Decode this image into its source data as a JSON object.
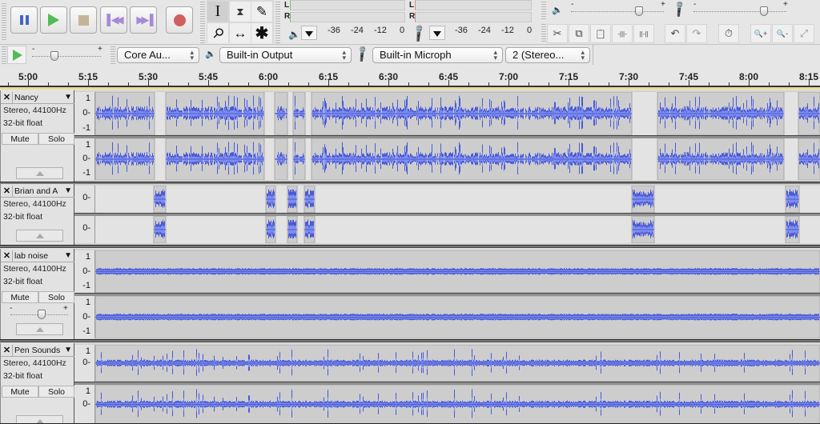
{
  "transport": {
    "buttons": [
      {
        "name": "pause-button",
        "icon": "pause-icon"
      },
      {
        "name": "play-button",
        "icon": "play-icon"
      },
      {
        "name": "stop-button",
        "icon": "stop-icon"
      },
      {
        "name": "skip-to-start-button",
        "icon": "skip-start-icon"
      },
      {
        "name": "skip-to-end-button",
        "icon": "skip-end-icon"
      },
      {
        "name": "record-button",
        "icon": "record-icon"
      }
    ]
  },
  "tools": {
    "selection": "I",
    "envelope": "⧗",
    "draw": "✎",
    "zoom": "⚲",
    "timeshift": "↔",
    "multi": "✱"
  },
  "meters": {
    "playback": {
      "L": "L",
      "R": "R",
      "ticks": [
        "-36",
        "-24",
        "-12",
        "0"
      ]
    },
    "recording": {
      "L": "L",
      "R": "R",
      "ticks": [
        "-36",
        "-24",
        "-12",
        "0"
      ]
    }
  },
  "mixer": {
    "output_volume": 0.75,
    "input_volume": 0.78,
    "minus": "-",
    "plus": "+"
  },
  "edit_toolbar": {
    "buttons": [
      "cut-icon",
      "copy-icon",
      "paste-icon",
      "trim-icon",
      "silence-icon",
      "undo-icon",
      "redo-icon",
      "sync-lock-icon",
      "zoom-in-icon",
      "zoom-out-icon",
      "fit-selection-icon"
    ],
    "glyphs": [
      "✂",
      "⧉",
      "📋",
      "-|||-",
      "||-||",
      "↶",
      "↷",
      "⏱",
      "🔍+",
      "🔍-",
      "⤢"
    ]
  },
  "device_toolbar": {
    "play_at_speed": 0.3,
    "host": "Core Au...",
    "output": "Built-in Output",
    "input": "Built-in Microph",
    "channels": "2 (Stereo..."
  },
  "timeline": {
    "labels": [
      "5:00",
      "5:15",
      "5:30",
      "5:45",
      "6:00",
      "6:15",
      "6:30",
      "6:45",
      "7:00",
      "7:15",
      "7:30",
      "7:45",
      "8:00",
      "8:15"
    ]
  },
  "tracks": [
    {
      "name": "Nancy",
      "format": "Stereo, 44100Hz",
      "bits": "32-bit float",
      "mute": "Mute",
      "solo": "Solo",
      "scale": [
        "1",
        "0",
        "-1"
      ],
      "style": "speech",
      "clips": [
        [
          0.0,
          0.082
        ],
        [
          0.097,
          0.233
        ],
        [
          0.247,
          0.265
        ],
        [
          0.273,
          0.29
        ],
        [
          0.298,
          0.74
        ],
        [
          0.776,
          0.95
        ],
        [
          0.97,
          1.0
        ]
      ]
    },
    {
      "name": "Brian and A",
      "format": "Stereo, 44100Hz",
      "bits": "32-bit float",
      "scale": [
        "0"
      ],
      "style": "bursts",
      "clips": [
        [
          0.081,
          0.097
        ],
        [
          0.235,
          0.249
        ],
        [
          0.265,
          0.279
        ],
        [
          0.288,
          0.303
        ],
        [
          0.74,
          0.771
        ],
        [
          0.952,
          0.971
        ]
      ]
    },
    {
      "name": "lab noise",
      "format": "Stereo, 44100Hz",
      "bits": "32-bit float",
      "mute": "Mute",
      "solo": "Solo",
      "gain": 0.55,
      "scale": [
        "1",
        "0",
        "-1"
      ],
      "style": "noise",
      "clips": [
        [
          0.0,
          1.0
        ]
      ]
    },
    {
      "name": "Pen Sounds",
      "format": "Stereo, 44100Hz",
      "bits": "32-bit float",
      "mute": "Mute",
      "solo": "Solo",
      "scale": [
        "1",
        "0"
      ],
      "style": "pen",
      "clips": [
        [
          0.0,
          1.0
        ]
      ]
    }
  ],
  "colors": {
    "waveform": "#4a5ad6",
    "waveform_rms": "#7f8ef0",
    "clip_bg": "#cdcdcd",
    "gap_bg": "#e4e4e4"
  }
}
